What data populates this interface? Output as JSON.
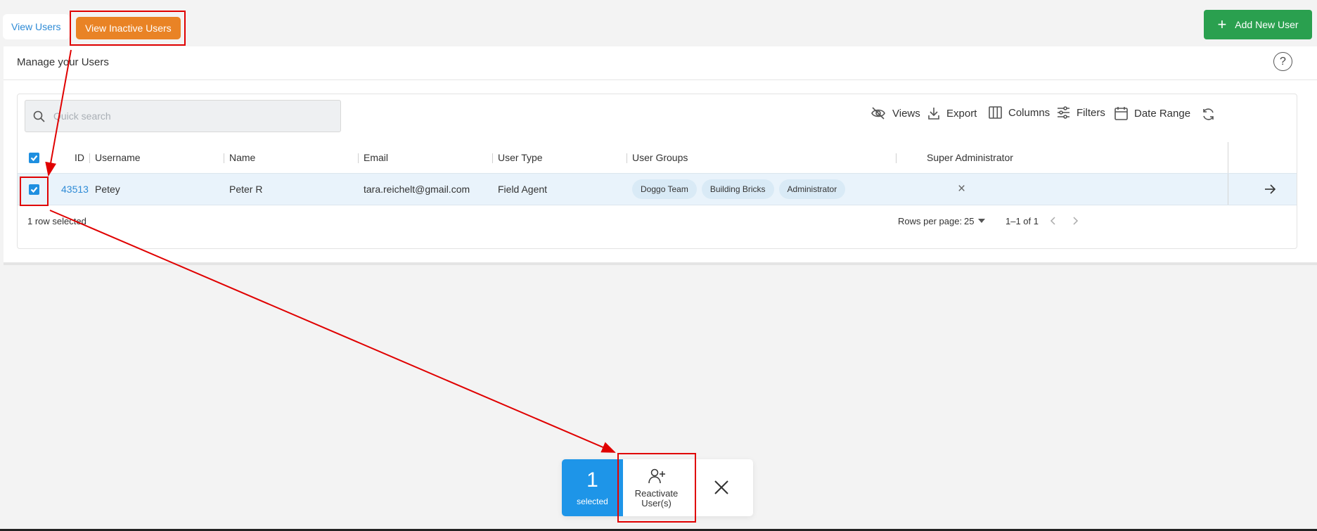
{
  "tabs": {
    "view_users": "View Users",
    "view_inactive": "View Inactive Users"
  },
  "add_user": {
    "label": "Add New User",
    "icon": "plus-icon"
  },
  "card": {
    "title": "Manage your Users",
    "help_icon": "help-icon"
  },
  "search": {
    "placeholder": "Quick search"
  },
  "toolbar": {
    "views": "Views",
    "export": "Export",
    "columns": "Columns",
    "filters": "Filters",
    "date_range": "Date Range"
  },
  "columns": {
    "id": "ID",
    "username": "Username",
    "name": "Name",
    "email": "Email",
    "user_type": "User Type",
    "user_groups": "User Groups",
    "super_admin": "Super Administrator"
  },
  "rows": [
    {
      "id": "43513",
      "username": "Petey",
      "name": "Peter R",
      "email": "tara.reichelt@gmail.com",
      "user_type": "Field Agent",
      "groups": [
        "Doggo Team",
        "Building Bricks",
        "Administrator"
      ],
      "super_admin": "×"
    }
  ],
  "footer": {
    "selected_text": "1 row selected",
    "rows_per_page_label": "Rows per page:",
    "rows_per_page": "25",
    "range": "1–1 of 1"
  },
  "action_bar": {
    "count": "1",
    "selected_label": "selected",
    "reactivate_label": "Reactivate User(s)"
  },
  "colors": {
    "accent_blue": "#1e95e8",
    "orange": "#e98325",
    "green": "#2aa04f",
    "annotation_red": "#e00000"
  }
}
